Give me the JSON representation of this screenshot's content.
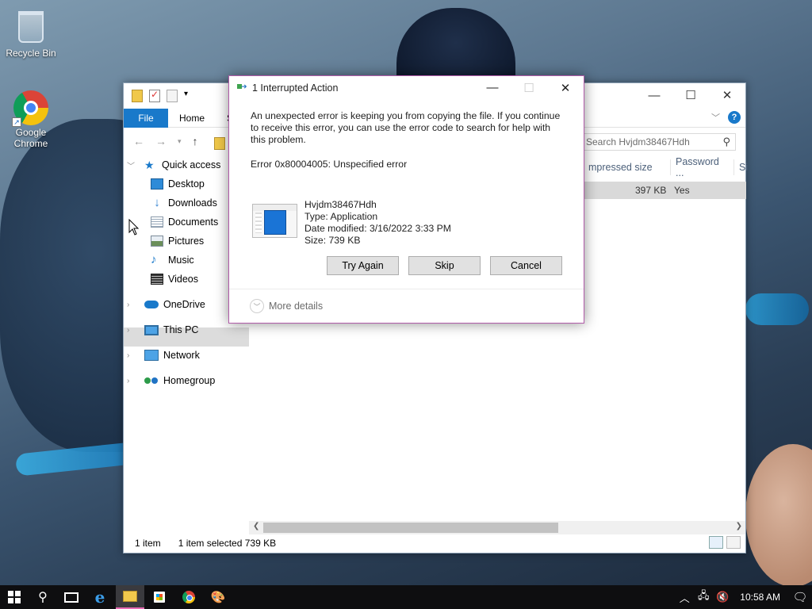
{
  "desktop": {
    "icons": [
      {
        "label": "Recycle Bin",
        "icon": "recycle-bin-icon"
      },
      {
        "label": "Google Chrome",
        "icon": "chrome-icon"
      }
    ]
  },
  "explorer": {
    "ribbon_tabs": {
      "file": "File",
      "home": "Home",
      "share": "S"
    },
    "search_placeholder": "Search Hvjdm38467Hdh",
    "nav": {
      "quick_access": "Quick access",
      "desktop": "Desktop",
      "downloads": "Downloads",
      "documents": "Documents",
      "pictures": "Pictures",
      "music": "Music",
      "videos": "Videos",
      "onedrive": "OneDrive",
      "this_pc": "This PC",
      "network": "Network",
      "homegroup": "Homegroup"
    },
    "columns": [
      "mpressed size",
      "Password ...",
      "Si"
    ],
    "row": {
      "compressed_size": "397 KB",
      "password": "Yes"
    },
    "status": {
      "count": "1 item",
      "selected": "1 item selected  739 KB"
    }
  },
  "dialog": {
    "title": "1 Interrupted Action",
    "message": "An unexpected error is keeping you from copying the file. If you continue to receive this error, you can use the error code to search for help with this problem.",
    "error": "Error 0x80004005: Unspecified error",
    "file": {
      "name": "Hvjdm38467Hdh",
      "type": "Type: Application",
      "modified": "Date modified: 3/16/2022 3:33 PM",
      "size": "Size: 739 KB"
    },
    "buttons": {
      "try_again": "Try Again",
      "skip": "Skip",
      "cancel": "Cancel"
    },
    "more_details": "More details"
  },
  "taskbar": {
    "time": "10:58 AM",
    "pinned": [
      "start-icon",
      "search-icon",
      "task-view-icon",
      "edge-icon",
      "file-explorer-icon",
      "store-icon",
      "chrome-icon",
      "paint-icon"
    ]
  }
}
